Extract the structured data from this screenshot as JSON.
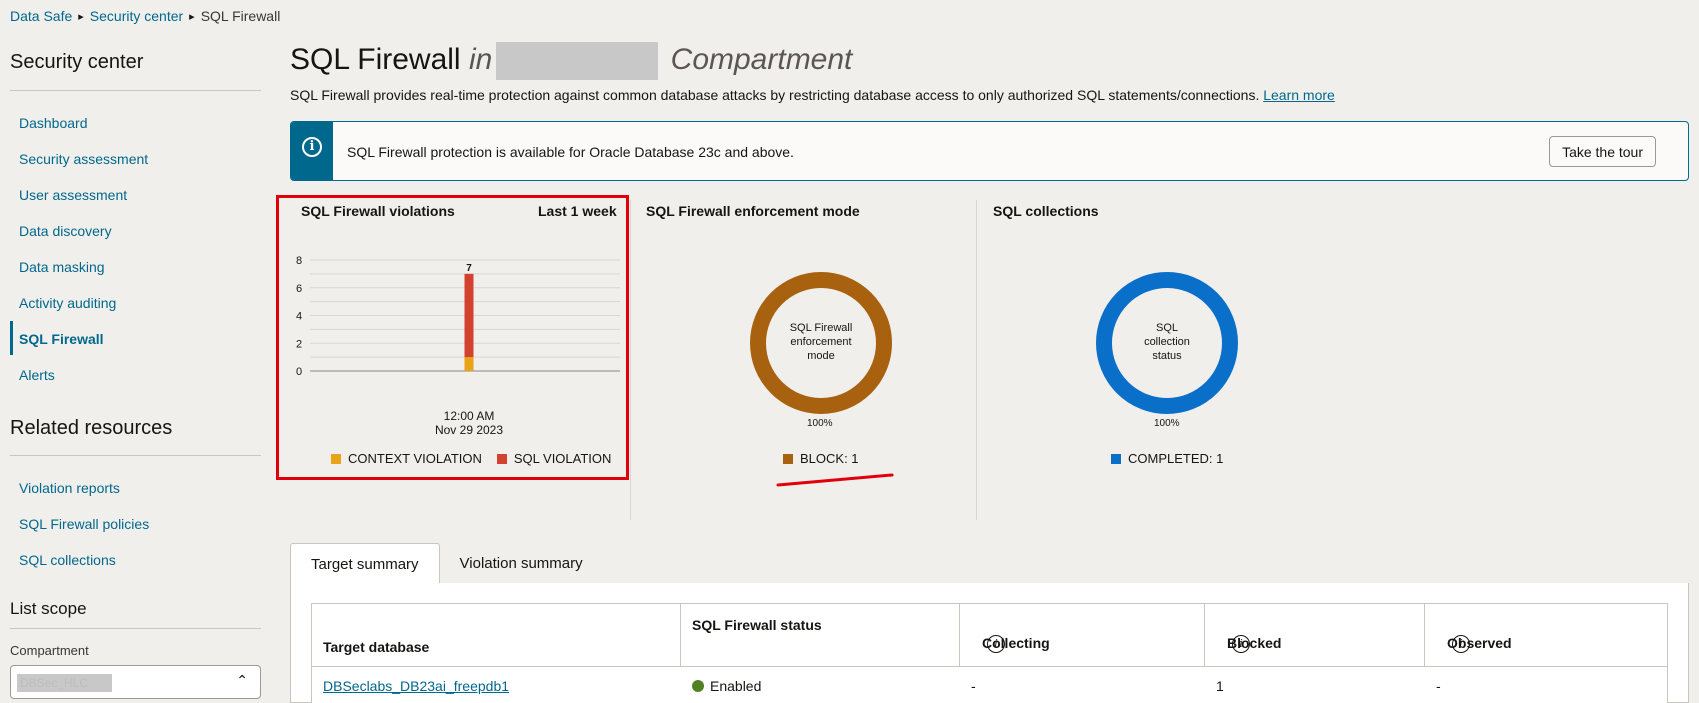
{
  "breadcrumb": {
    "items": [
      "Data Safe",
      "Security center",
      "SQL Firewall"
    ]
  },
  "sidebar": {
    "heading": "Security center",
    "items": [
      {
        "label": "Dashboard"
      },
      {
        "label": "Security assessment"
      },
      {
        "label": "User assessment"
      },
      {
        "label": "Data discovery"
      },
      {
        "label": "Data masking"
      },
      {
        "label": "Activity auditing"
      },
      {
        "label": "SQL Firewall",
        "active": true
      },
      {
        "label": "Alerts"
      }
    ],
    "related_heading": "Related resources",
    "related_items": [
      {
        "label": "Violation reports"
      },
      {
        "label": "SQL Firewall policies"
      },
      {
        "label": "SQL collections"
      }
    ],
    "scope_heading": "List scope",
    "compartment_label": "Compartment",
    "compartment_value": "DBSec_HLC"
  },
  "page": {
    "title": "SQL Firewall",
    "title_in": "in",
    "title_compartment": "Compartment",
    "description": "SQL Firewall provides real-time protection against common database attacks by restricting database access to only authorized SQL statements/connections.",
    "learn_more": "Learn more"
  },
  "banner": {
    "icon": "info-icon",
    "message": "SQL Firewall protection is available for Oracle Database 23c and above.",
    "tour_button": "Take the tour"
  },
  "violations_widget": {
    "title": "SQL Firewall violations",
    "period": "Last 1 week",
    "x_label_line1": "12:00 AM",
    "x_label_line2": "Nov 29 2023",
    "legend": [
      {
        "label": "CONTEXT VIOLATION",
        "color": "#e8a317"
      },
      {
        "label": "SQL VIOLATION",
        "color": "#d3412f"
      }
    ]
  },
  "chart_data": {
    "type": "bar",
    "stacked": true,
    "categories": [
      "12:00 AM Nov 29 2023"
    ],
    "series": [
      {
        "name": "CONTEXT VIOLATION",
        "values": [
          1
        ],
        "color": "#e8a317"
      },
      {
        "name": "SQL VIOLATION",
        "values": [
          6
        ],
        "color": "#d3412f"
      }
    ],
    "totals": [
      7
    ],
    "yticks": [
      0,
      2,
      4,
      6,
      8
    ],
    "ylim": [
      0,
      8
    ],
    "grid": true,
    "legend_position": "bottom"
  },
  "enforcement_widget": {
    "title": "SQL Firewall enforcement mode",
    "center_line1": "SQL Firewall",
    "center_line2": "enforcement",
    "center_line3": "mode",
    "percent": "100%",
    "legend": "BLOCK: 1",
    "color": "#a8620f"
  },
  "collections_widget": {
    "title": "SQL collections",
    "center_line1": "SQL",
    "center_line2": "collection",
    "center_line3": "status",
    "percent": "100%",
    "legend": "COMPLETED: 1",
    "color": "#0a6fc9"
  },
  "tabs": [
    {
      "label": "Target summary",
      "active": true
    },
    {
      "label": "Violation summary"
    }
  ],
  "table": {
    "headers": [
      "Target database",
      "SQL Firewall status",
      "Collecting",
      "Blocked",
      "Observed"
    ],
    "rows": [
      {
        "target": "DBSeclabs_DB23ai_freepdb1",
        "status": "Enabled",
        "collecting": "-",
        "blocked": "1",
        "observed": "-"
      }
    ]
  }
}
